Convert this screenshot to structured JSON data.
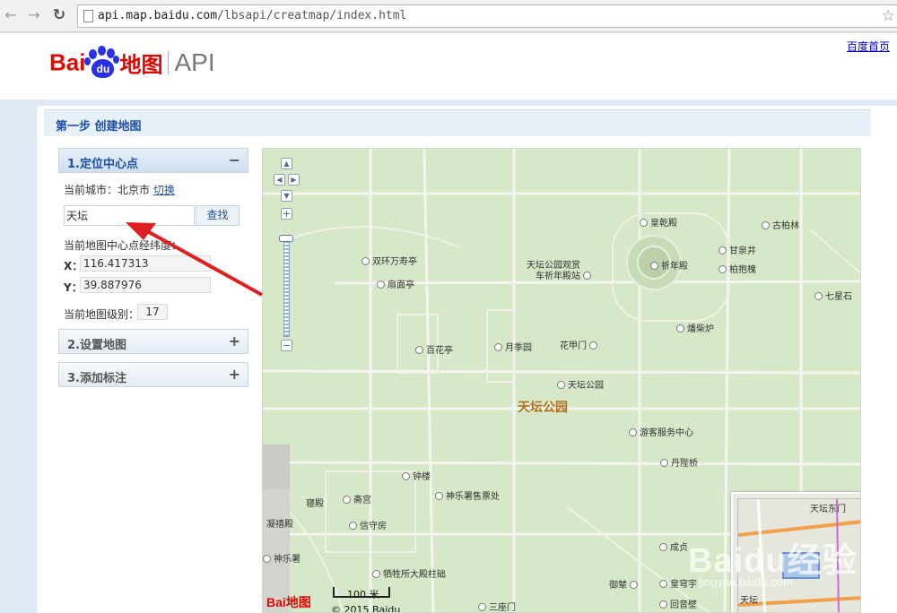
{
  "browser": {
    "url_host": "api.map.baidu.com",
    "url_path": "/lbsapi/creatmap/index.html"
  },
  "header": {
    "logo_bai": "Bai",
    "logo_du": "du",
    "logo_map": "地图",
    "logo_api": "API",
    "home_link": "百度首页"
  },
  "step": {
    "title": "第一步 创建地图"
  },
  "sidebar": {
    "section1": {
      "title": "1.定位中心点",
      "toggle": "−",
      "current_city_label": "当前城市：北京市",
      "switch_label": "切换",
      "search_value": "天坛",
      "search_button": "查找",
      "center_label": "当前地图中心点经纬度：",
      "x_key": "X：",
      "x_value": "116.417313",
      "y_key": "Y：",
      "y_value": "39.887976",
      "zoom_label": "当前地图级别：",
      "zoom_value": "17"
    },
    "section2": {
      "title": "2.设置地图",
      "toggle": "+"
    },
    "section3": {
      "title": "3.添加标注",
      "toggle": "+"
    }
  },
  "map": {
    "park_name": "天坛公园",
    "pois": {
      "huangqiandian": "皇乾殿",
      "gubolin": "古柏林",
      "shuanghuan": "双环万寿亭",
      "tiantan_guanshang": "天坛公园观赏",
      "qinian_zhan": "车祈年殿站",
      "qiniandian": "祈年殿",
      "ganquanjing": "甘泉井",
      "baiyou": "柏抱槐",
      "shanmianting": "扇面亭",
      "qixingshi": "七星石",
      "zaichailu": "燔柴炉",
      "baihuating": "百花亭",
      "yuejiyuan": "月季园",
      "huaxiangmen": "花甲门",
      "tiantan_gongyuan": "天坛公园",
      "youke_zhongxin": "游客服务中心",
      "danbiqiao": "丹陛桥",
      "zhonglou": "钟楼",
      "qingong": "斋宫",
      "shenyue_shoupiao": "神乐署售票处",
      "qingdian": "寝殿",
      "xinshoufang": "信守房",
      "ningfudian": "凝禧殿",
      "shenyueshu": "神乐署",
      "xishengsuo": "牺牲所大殿柱础",
      "sanzhumen": "三座门",
      "yulu": "御辇",
      "huangqiongyu": "皇穹宇",
      "huiyinbi": "回音壁",
      "chengzhen": "成贞"
    },
    "scale_label": "100 米",
    "copyright": "© 2015 Baidu",
    "logo_text": "Bai地图",
    "watermark": "Baidu经验",
    "watermark_sub": "jingyan.baidu.com",
    "overview_label": "天坛东门",
    "overview_label2": "天坛"
  }
}
